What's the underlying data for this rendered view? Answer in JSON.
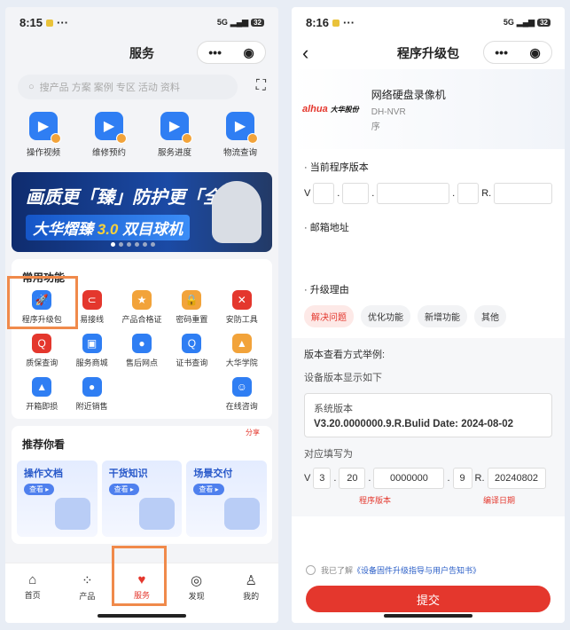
{
  "left": {
    "status": {
      "time": "8:15",
      "network": "5G",
      "battery": "32"
    },
    "title": "服务",
    "search": {
      "placeholder": "搜产品 方案 案例 专区 活动 资料"
    },
    "quick": [
      {
        "label": "操作视频",
        "icon": "play-icon"
      },
      {
        "label": "维修预约",
        "icon": "wrench-icon"
      },
      {
        "label": "服务进度",
        "icon": "heart-icon"
      },
      {
        "label": "物流查询",
        "icon": "truck-icon"
      }
    ],
    "banner": {
      "line1": "画质更「臻」防护更「全」",
      "line2_pre": "大华熠臻",
      "line2_ver": "3.0",
      "line2_post": "双目球机"
    },
    "common": {
      "title": "常用功能",
      "items": [
        {
          "label": "程序升级包",
          "color": "#2f7ef3",
          "glyph": "🚀"
        },
        {
          "label": "易接线",
          "color": "#e4372d",
          "glyph": "⊂"
        },
        {
          "label": "产品合格证",
          "color": "#f2a33a",
          "glyph": "★"
        },
        {
          "label": "密码重置",
          "color": "#f2a33a",
          "glyph": "🔒"
        },
        {
          "label": "安防工具",
          "color": "#e4372d",
          "glyph": "✕"
        },
        {
          "label": "质保查询",
          "color": "#e4372d",
          "glyph": "Q"
        },
        {
          "label": "服务商城",
          "color": "#2f7ef3",
          "glyph": "▣"
        },
        {
          "label": "售后网点",
          "color": "#2f7ef3",
          "glyph": "●"
        },
        {
          "label": "证书查询",
          "color": "#2f7ef3",
          "glyph": "Q"
        },
        {
          "label": "大华学院",
          "color": "#f2a33a",
          "glyph": "▲"
        },
        {
          "label": "开箱即损",
          "color": "#2f7ef3",
          "glyph": "▲"
        },
        {
          "label": "附近销售",
          "color": "#2f7ef3",
          "glyph": "●"
        },
        {
          "label": "",
          "color": "#ffffff",
          "glyph": ""
        },
        {
          "label": "",
          "color": "#ffffff",
          "glyph": ""
        },
        {
          "label": "在线咨询",
          "color": "#2f7ef3",
          "glyph": "☺"
        }
      ]
    },
    "recommend": {
      "title": "推荐你看",
      "share": "分享",
      "cards": [
        {
          "title": "操作文档",
          "btn": "查看 ▸"
        },
        {
          "title": "干货知识",
          "btn": "查看 ▸"
        },
        {
          "title": "场景交付",
          "btn": "查看 ▸"
        }
      ]
    },
    "tabs": [
      {
        "label": "首页",
        "icon": "⌂"
      },
      {
        "label": "产品",
        "icon": "⁘"
      },
      {
        "label": "服务",
        "icon": "♥"
      },
      {
        "label": "发现",
        "icon": "◎"
      },
      {
        "label": "我的",
        "icon": "♙"
      }
    ],
    "accent": "#e4372d"
  },
  "right": {
    "status": {
      "time": "8:16",
      "network": "5G",
      "battery": "32"
    },
    "title": "程序升级包",
    "product": {
      "logo_brand": "alhua",
      "logo_text": "大华股份",
      "name": "网络硬盘录像机",
      "model": "DH-NVR",
      "serial": "序"
    },
    "version_label": "当前程序版本",
    "version_prefix": "V",
    "version_r": "R.",
    "email_label": "邮箱地址",
    "reason_label": "升级理由",
    "reasons": [
      "解决问题",
      "优化功能",
      "新增功能",
      "其他"
    ],
    "example": {
      "title": "版本查看方式举例:",
      "desc": "设备版本显示如下",
      "sys_label": "系统版本",
      "sys_value": "V3.20.0000000.9.R.Bulid Date: 2024-08-02",
      "fill_label": "对应填写为",
      "fill": [
        "3",
        "20",
        "0000000",
        "9",
        "20240802"
      ],
      "program_version": "程序版本",
      "compile_date": "编译日期"
    },
    "agree_prefix": "我已了解",
    "agree_link": "《设备固件升级指导与用户告知书》",
    "submit": "提交"
  }
}
